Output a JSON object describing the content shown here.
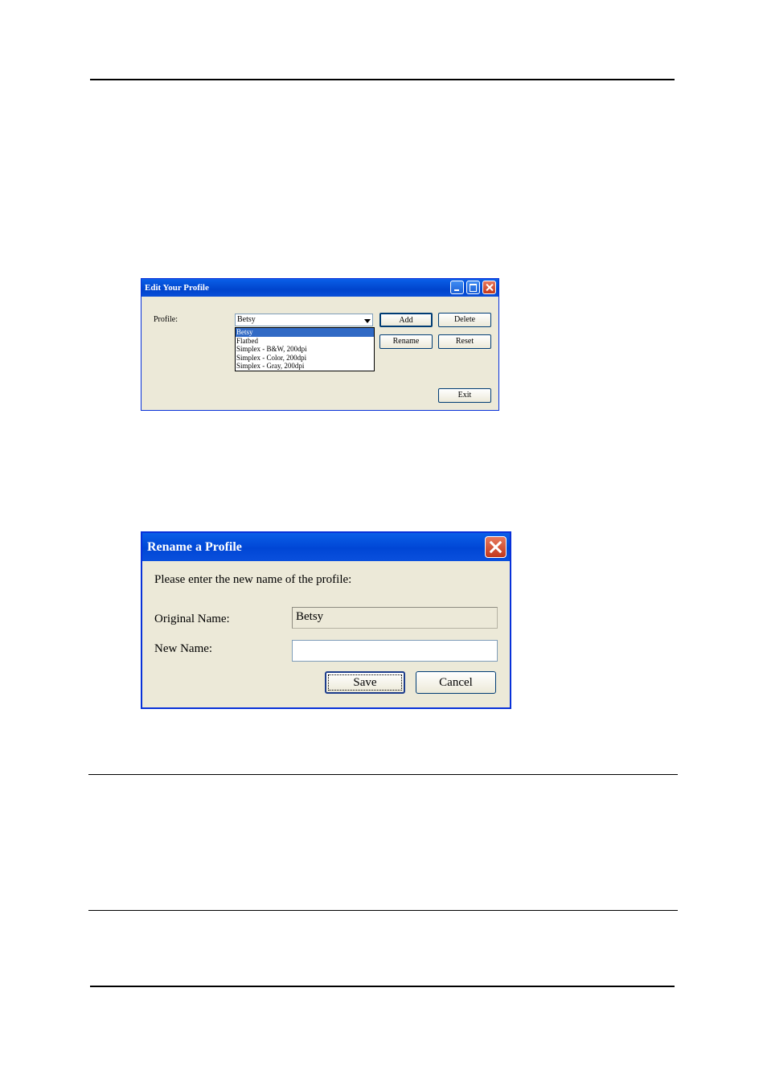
{
  "edit_profile_dialog": {
    "title": "Edit Your Profile",
    "profile_label": "Profile:",
    "profile_value": "Betsy",
    "profile_options": [
      "Betsy",
      "Flatbed",
      "Simplex - B&W, 200dpi",
      "Simplex - Color, 200dpi",
      "Simplex - Gray, 200dpi"
    ],
    "buttons": {
      "add": "Add",
      "delete": "Delete",
      "rename": "Rename",
      "reset": "Reset",
      "exit": "Exit"
    }
  },
  "rename_dialog": {
    "title": "Rename a Profile",
    "prompt": "Please enter the new name of the profile:",
    "original_name_label": "Original Name:",
    "original_name_value": "Betsy",
    "new_name_label": "New Name:",
    "new_name_value": "",
    "save_label": "Save",
    "cancel_label": "Cancel"
  }
}
